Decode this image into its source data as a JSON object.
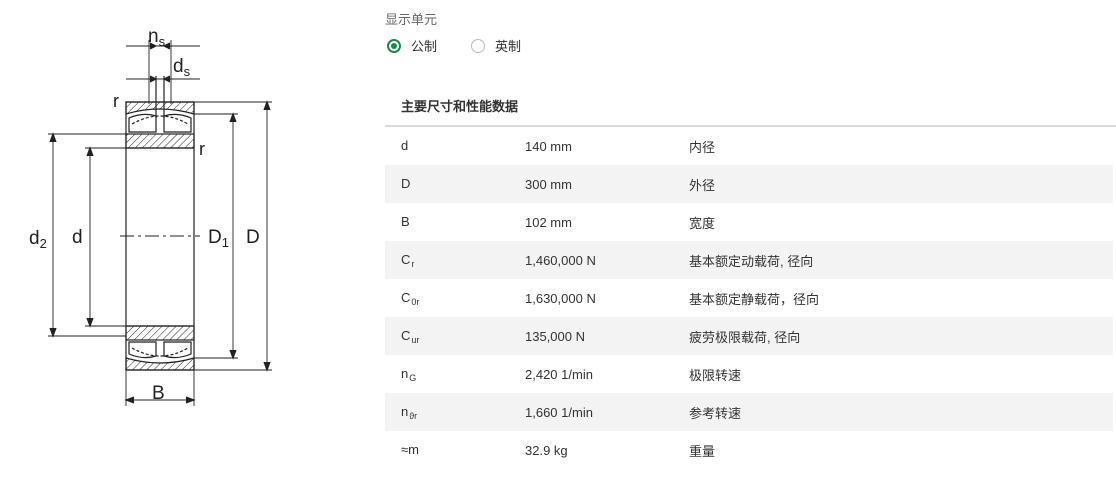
{
  "drawing": {
    "labels": {
      "ns_main": "n",
      "ns_sub": "s",
      "ds_main": "d",
      "ds_sub": "s",
      "r_top": "r",
      "r_inner": "r",
      "d2_main": "d",
      "d2_sub": "2",
      "d": "d",
      "D1_main": "D",
      "D1_sub": "1",
      "D": "D",
      "B": "B"
    }
  },
  "units": {
    "label": "显示单元",
    "options": [
      {
        "label": "公制",
        "selected": true
      },
      {
        "label": "英制",
        "selected": false
      }
    ]
  },
  "section": {
    "title": "主要尺寸和性能数据"
  },
  "rows": [
    {
      "sym": "d",
      "sub": "",
      "value": "140 mm",
      "desc": "内径"
    },
    {
      "sym": "D",
      "sub": "",
      "value": "300 mm",
      "desc": "外径"
    },
    {
      "sym": "B",
      "sub": "",
      "value": "102 mm",
      "desc": "宽度"
    },
    {
      "sym": "C",
      "sub": "r",
      "value": "1,460,000 N",
      "desc": "基本额定动载荷, 径向"
    },
    {
      "sym": "C",
      "sub": "0r",
      "value": "1,630,000 N",
      "desc": "基本额定静载荷，径向"
    },
    {
      "sym": "C",
      "sub": "ur",
      "value": "135,000 N",
      "desc": "疲劳极限载荷, 径向"
    },
    {
      "sym": "n",
      "sub": "G",
      "value": "2,420 1/min",
      "desc": "极限转速"
    },
    {
      "sym": "n",
      "sub": "ϑr",
      "value": "1,660 1/min",
      "desc": "参考转速"
    },
    {
      "sym": "≈m",
      "sub": "",
      "value": "32.9 kg",
      "desc": "重量"
    }
  ]
}
